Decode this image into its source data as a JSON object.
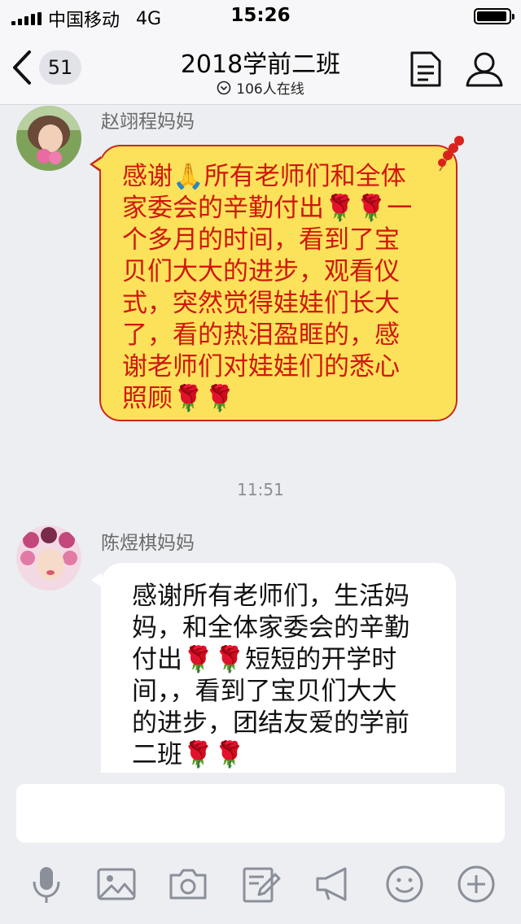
{
  "status_bar": {
    "carrier": "中国移动",
    "network": "4G",
    "time": "15:26",
    "battery_level": 0.95
  },
  "nav": {
    "unread_count": "51",
    "title": "2018学前二班",
    "online": "106人在线",
    "icons": [
      "back-chevron-icon",
      "document-icon",
      "members-icon",
      "online-status-icon"
    ]
  },
  "messages": [
    {
      "sender": "赵翊程妈妈",
      "lines": [
        "感谢🙏所有老师们和全体",
        "家委会的辛勤付出🌹🌹一",
        "个多月的时间，看到了宝",
        "贝们大大的进步，观看仪",
        "式，突然觉得娃娃们长大",
        "了，看的热泪盈眶的，感",
        "谢老师们对娃娃们的悉心",
        "照顾🌹🌹"
      ],
      "bubble_style": "yellow-red"
    },
    {
      "sender": "陈煜棋妈妈",
      "lines": [
        "感谢所有老师们，生活妈",
        "妈，和全体家委会的辛勤",
        "付出🌹🌹短短的开学时",
        "间，，看到了宝贝们大大",
        "的进步，团结友爱的学前",
        "二班🌹🌹"
      ],
      "bubble_style": "white"
    }
  ],
  "timestamp": "11:51",
  "input": {
    "value": "",
    "placeholder": ""
  },
  "toolbar": [
    "microphone-icon",
    "image-icon",
    "camera-icon",
    "edit-icon",
    "megaphone-icon",
    "emoji-icon",
    "plus-icon"
  ],
  "colors": {
    "background": "#eceef2",
    "bubble_yellow": "#fbe25a",
    "bubble_text_red": "#d0170c",
    "bubble_border_red": "#c8281c",
    "icon_gray": "#8a8f99"
  }
}
